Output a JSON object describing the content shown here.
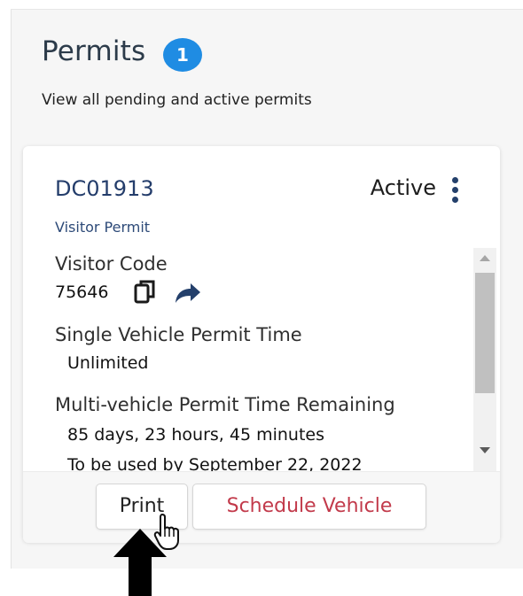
{
  "header": {
    "title": "Permits",
    "count": "1",
    "subtitle": "View all pending and active permits"
  },
  "permit": {
    "id": "DC01913",
    "status": "Active",
    "type": "Visitor Permit",
    "visitor_code_label": "Visitor Code",
    "visitor_code": "75646",
    "single_label": "Single Vehicle Permit Time",
    "single_value": "Unlimited",
    "multi_label": "Multi-vehicle Permit Time Remaining",
    "multi_value": "85 days, 23 hours, 45 minutes",
    "use_by": "To be used by September 22, 2022"
  },
  "actions": {
    "print": "Print",
    "schedule": "Schedule Vehicle"
  },
  "colors": {
    "accent": "#1f8ce3",
    "link": "#243d6b",
    "danger": "#c23a4b"
  },
  "icons": [
    "copy-icon",
    "share-icon",
    "more-vertical-icon",
    "hand-pointer-icon",
    "arrow-up-icon"
  ]
}
